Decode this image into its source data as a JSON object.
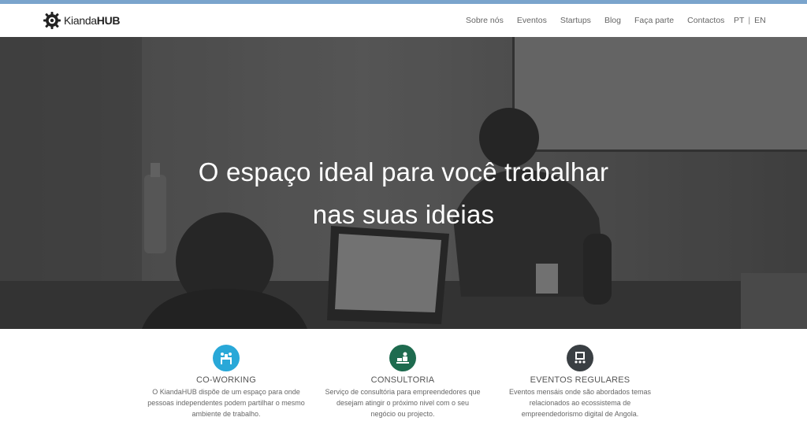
{
  "brand": {
    "logo_text_light": "Kianda",
    "logo_text_bold": "HUB"
  },
  "nav": {
    "items": [
      "Sobre nós",
      "Eventos",
      "Startups",
      "Blog",
      "Faça parte",
      "Contactos"
    ],
    "lang_pt": "PT",
    "lang_sep": "|",
    "lang_en": "EN"
  },
  "hero": {
    "line1": "O espaço ideal para você trabalhar",
    "line2": "nas suas ideias"
  },
  "features": [
    {
      "icon": "coworking-icon",
      "color": "#29a8d8",
      "title": "CO-WORKING",
      "desc1": "O KiandaHUB dispõe de um espaço para onde",
      "desc2": "pessoas independentes podem partilhar o mesmo",
      "desc3": "ambiente de trabalho."
    },
    {
      "icon": "consulting-icon",
      "color": "#1e6b4f",
      "title": "CONSULTORIA",
      "desc1": "Serviço de consultória para empreendedores que",
      "desc2": "desejam atingir o próximo nivel com o seu",
      "desc3": "negócio ou projecto."
    },
    {
      "icon": "events-icon",
      "color": "#3a3f43",
      "title": "EVENTOS REGULARES",
      "desc1": "Eventos mensáis onde são abordados temas",
      "desc2": "relacionados ao ecossistema de",
      "desc3": "empreendedorismo digital de Angola."
    }
  ]
}
